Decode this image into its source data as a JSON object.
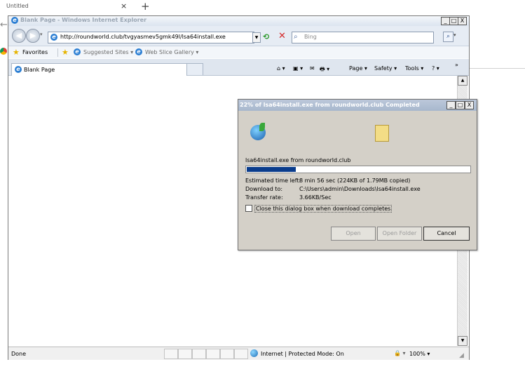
{
  "outer_browser": {
    "tab_title": "Untitled",
    "tab_close": "×",
    "new_tab": "+",
    "back": "←"
  },
  "ie": {
    "window_title": "Blank Page - Windows Internet Explorer",
    "caption_buttons": {
      "minimize": "_",
      "maximize": "□",
      "close": "X"
    },
    "address_url": "http://roundworld.club/tvgyasmev5gmk49l/lsa64install.exe",
    "search_placeholder": "Bing",
    "favorites": {
      "label": "Favorites",
      "suggested_sites": "Suggested Sites ▾",
      "web_slice_gallery": "Web Slice Gallery ▾"
    },
    "tab_title": "Blank Page",
    "command_bar": {
      "home": "⌂ ▾",
      "feeds": "▣ ▾",
      "mail": "✉",
      "print": "🖶 ▾",
      "page": "Page ▾",
      "safety": "Safety ▾",
      "tools": "Tools ▾",
      "help": "? ▾",
      "more": "»"
    },
    "status": {
      "left_text": "Done",
      "zone": "Internet | Protected Mode: On",
      "security_icon": "🔒 ▾",
      "zoom": "100%  ▾"
    }
  },
  "download_dialog": {
    "title": "22% of lsa64install.exe from roundworld.club Completed",
    "caption_buttons": {
      "minimize": "_",
      "maximize": "□",
      "close": "X"
    },
    "file_line": "lsa64install.exe from roundworld.club",
    "progress_percent": 22,
    "rows": [
      {
        "label": "Estimated time left:",
        "value": "8 min 56 sec (224KB of 1.79MB copied)"
      },
      {
        "label": "Download to:",
        "value": "C:\\Users\\admin\\Downloads\\lsa64install.exe"
      },
      {
        "label": "Transfer rate:",
        "value": "3.66KB/Sec"
      }
    ],
    "close_checkbox_label": "Close this dialog box when download completes",
    "close_checkbox_checked": false,
    "buttons": {
      "open": "Open",
      "open_folder": "Open Folder",
      "cancel": "Cancel"
    }
  }
}
